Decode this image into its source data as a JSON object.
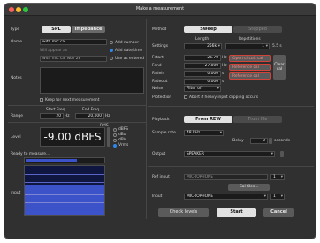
{
  "window": {
    "title": "Make a measurement"
  },
  "left": {
    "type_label": "Type",
    "tab_spl": "SPL",
    "tab_impedance": "Impedance",
    "name_label": "Name",
    "name_value": "with mic cal",
    "will_appear_as": "Will appear as",
    "appear_value": "with mic cal Nov 28",
    "add_number": "Add number",
    "add_date_time": "Add date/time",
    "use_as_entered": "Use as entered",
    "notes_label": "Notes",
    "keep_for_next": "Keep for next measurement",
    "start_freq": "Start Freq",
    "end_freq": "End Freq",
    "range_label": "Range",
    "start_value": "20",
    "end_value": "20,000",
    "hz1": "Hz",
    "hz2": "Hz",
    "rms_label": "RMS",
    "level_label": "Level",
    "level_value": "-9.00 dBFS",
    "unit_dbfs": "dBFS",
    "unit_dbu": "dBu",
    "unit_dbv": "dBV",
    "unit_vrms": "Vrms",
    "ready": "Ready to measure...",
    "input_label": "Input",
    "meter_value": "-18.0"
  },
  "right": {
    "method_label": "Method",
    "tab_sweep": "Sweep",
    "tab_stepped": "Stepped",
    "length_label": "Length",
    "repetitions_label": "Repetitions",
    "settings_label": "Settings",
    "length_value": "256k",
    "rep_value": "1",
    "time_value": "5.5 s",
    "fstart_label": "Fstart",
    "fstart_value": "26.70",
    "fend_label": "Fend",
    "fend_value": "27,000",
    "fadein_label": "Fadein",
    "fadein_value": "0.000",
    "fadeout_label": "Fadeout",
    "fadeout_value": "0.000",
    "open_circuit": "Open circuit cal",
    "reference_cal": "Reference cal",
    "reference_cal_sub": "Reference cal",
    "sec": "s",
    "sec2": "s",
    "clear_cal": "Clear cal",
    "hz_unit": "Hz",
    "hz_unit2": "Hz",
    "noise_label": "Noise",
    "noise_value": "Filter off",
    "protection_label": "Protection",
    "abort_text": "Abort if heavy input clipping occurs",
    "playback_label": "Playback",
    "from_rew": "From REW",
    "from_file": "From file",
    "sample_rate_label": "Sample rate",
    "sample_rate_value": "48 kHz",
    "delay_label": "Delay",
    "delay_value": "0",
    "delay_unit": "seconds",
    "output_label": "Output",
    "output_value": "SPEAKER",
    "ref_input_label": "Ref input",
    "ref_input_value": "MICROPHONE",
    "cal_files": "Cal files...",
    "input_label": "Input",
    "input_value": "MICROPHONE",
    "ch_value": "1"
  },
  "footer": {
    "check_levels": "Check levels",
    "start": "Start",
    "cancel": "Cancel"
  },
  "colors": {
    "accent": "#2f86e8",
    "alert": "#d0443a",
    "meter": "#3b52c8"
  }
}
